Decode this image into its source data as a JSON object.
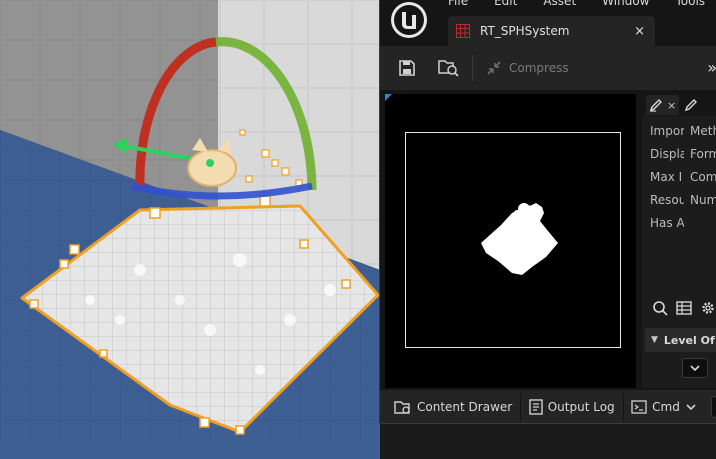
{
  "menu": {
    "file": "File",
    "edit": "Edit",
    "asset": "Asset",
    "window": "Window",
    "tools": "Tools"
  },
  "tab": {
    "title": "RT_SPHSystem",
    "close": "×"
  },
  "toolbar": {
    "compress_label": "Compress",
    "more": "»"
  },
  "details": {
    "tabs": [
      {
        "close": "×"
      }
    ],
    "col1": [
      "Impor",
      "Displa",
      "Max I",
      "Resou",
      "Has A"
    ],
    "col2": [
      "Meth",
      "Form",
      "Com",
      "Num"
    ],
    "lod_label": "Level Of"
  },
  "bottombar": {
    "content_drawer": "Content Drawer",
    "output_log": "Output Log",
    "cmd": "Cmd"
  },
  "colors": {
    "accent_blue": "#2f7fe0",
    "particle_outline": "#f0a020",
    "gizmo_red": "#c03020",
    "gizmo_green": "#70b030",
    "gizmo_blue": "#3050d0"
  },
  "icons": [
    "unreal-logo-icon",
    "texture-asset-icon",
    "save-icon",
    "browse-asset-icon",
    "compress-icon",
    "edit-pencil-icon",
    "search-icon",
    "grid-view-icon",
    "settings-gear-icon",
    "content-drawer-icon",
    "output-log-icon",
    "cmd-console-icon",
    "chevron-down-icon"
  ]
}
